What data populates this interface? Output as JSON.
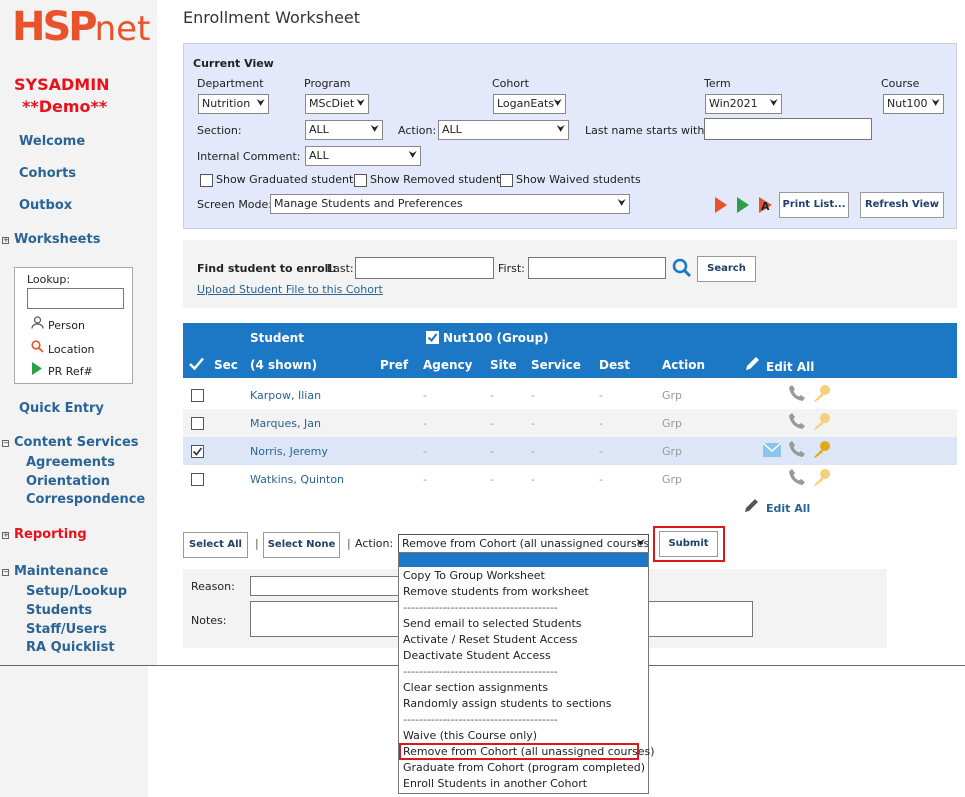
{
  "logo": {
    "a": "HSP",
    "b": "net"
  },
  "sidebar": {
    "role": "SYSADMIN",
    "demo": "**Demo**",
    "welcome": "Welcome",
    "cohorts": "Cohorts",
    "outbox": "Outbox",
    "worksheets": "Worksheets",
    "lookup_title": "Lookup:",
    "lookup_person": "Person",
    "lookup_location": "Location",
    "lookup_pr": "PR Ref#",
    "quick_entry": "Quick Entry",
    "content_services": "Content Services",
    "agreements": "Agreements",
    "orientation": "Orientation",
    "correspondence": "Correspondence",
    "reporting": "Reporting",
    "maintenance": "Maintenance",
    "setup": "Setup/Lookup",
    "students": "Students",
    "staff": "Staff/Users",
    "ra": "RA Quicklist"
  },
  "page_title": "Enrollment Worksheet",
  "current_view": {
    "heading": "Current View",
    "department_label": "Department",
    "department": "Nutrition",
    "program_label": "Program",
    "program": "MScDiet",
    "cohort_label": "Cohort",
    "cohort": "LoganEats",
    "term_label": "Term",
    "term": "Win2021",
    "course_label": "Course",
    "course": "Nut100",
    "section_label": "Section:",
    "section": "ALL",
    "action_label": "Action:",
    "action": "ALL",
    "lastname_label": "Last name starts with:",
    "comment_label": "Internal Comment:",
    "comment": "ALL",
    "show_graduated": "Show Graduated students",
    "show_removed": "Show Removed students",
    "show_waived": "Show Waived students",
    "screen_mode_label": "Screen Mode:",
    "screen_mode": "Manage Students and Preferences",
    "print_button": "Print List...",
    "refresh_button": "Refresh View"
  },
  "find": {
    "label": "Find student to enroll:",
    "last_label": "Last:",
    "first_label": "First:",
    "search_button": "Search",
    "upload_link": "Upload Student File to this Cohort"
  },
  "grid": {
    "student_header": "Student",
    "course_group": "Nut100  (Group)",
    "sec": "Sec",
    "shown": "(4 shown)",
    "pref": "Pref",
    "agency": "Agency",
    "site": "Site",
    "service": "Service",
    "dest": "Dest",
    "action": "Action",
    "edit_all": "Edit All",
    "rows": [
      {
        "name": "Karpow, Ilian",
        "agency": "-",
        "site": "-",
        "service": "-",
        "dest": "-",
        "action": "Grp"
      },
      {
        "name": "Marques, Jan",
        "agency": "-",
        "site": "-",
        "service": "-",
        "dest": "-",
        "action": "Grp"
      },
      {
        "name": "Norris, Jeremy",
        "agency": "-",
        "site": "-",
        "service": "-",
        "dest": "-",
        "action": "Grp"
      },
      {
        "name": "Watkins, Quinton",
        "agency": "-",
        "site": "-",
        "service": "-",
        "dest": "-",
        "action": "Grp"
      }
    ],
    "edit_all_bottom": "Edit All"
  },
  "actions": {
    "select_all": "Select All",
    "select_none": "Select None",
    "sep": "|",
    "action_label": "Action:",
    "selected": "Remove from Cohort (all unassigned courses)",
    "submit": "Submit",
    "reason_label": "Reason:",
    "notes_label": "Notes:"
  },
  "dropdown_options": [
    "Copy To Group Worksheet",
    "Remove students from worksheet",
    "---------------------------------------",
    "Send email to selected Students",
    "Activate / Reset Student Access",
    "Deactivate Student Access",
    "---------------------------------------",
    "Clear section assignments",
    "Randomly assign students to sections",
    "---------------------------------------",
    "Waive (this Course only)",
    "Remove from Cohort (all unassigned courses)",
    "Graduate from Cohort (program completed)",
    "Enroll Students in another Cohort"
  ],
  "colors": {
    "accent": "#1c78c4",
    "brand": "#e8532c",
    "alert": "#d71920"
  }
}
